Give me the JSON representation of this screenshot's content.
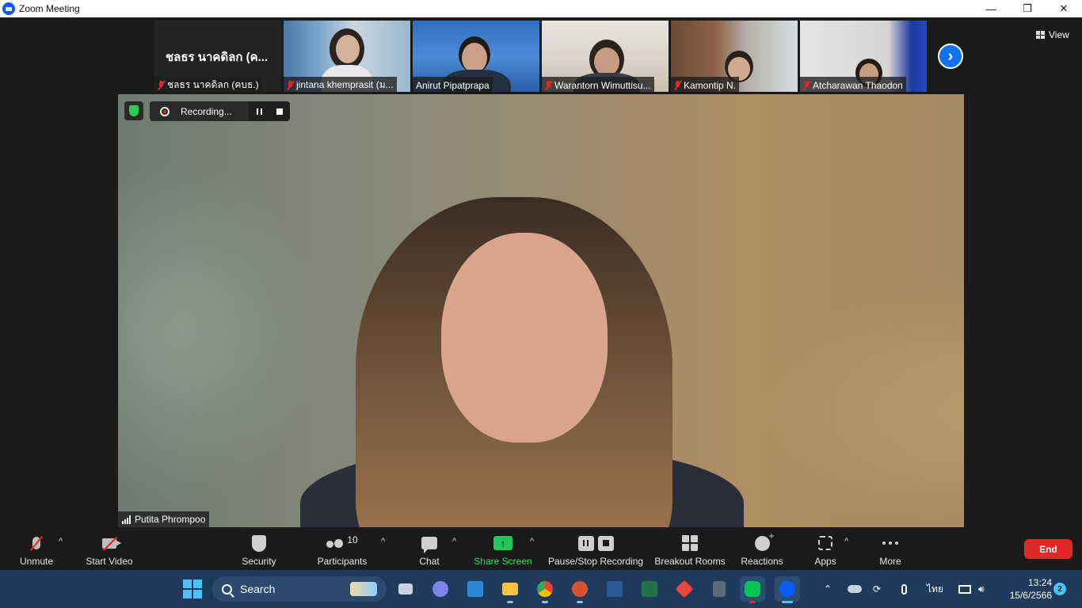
{
  "window": {
    "title": "Zoom Meeting",
    "buttons": {
      "minimize": "—",
      "restore": "❐",
      "close": "✕"
    }
  },
  "gallery": {
    "namecard": {
      "big_name": "ชลธร นาคดิลก (ค...",
      "label": "ชลธร นาคดิลก (คบธ.)"
    },
    "participants": [
      {
        "name": "jintana khemprasit (ม...",
        "muted": true
      },
      {
        "name": "Anirut Pipatprapa",
        "muted": false
      },
      {
        "name": "Warantorn Wimuttisu...",
        "muted": true
      },
      {
        "name": "Kamontip N.",
        "muted": true
      },
      {
        "name": "Atcharawan Thaodon",
        "muted": true
      }
    ],
    "next_icon": "chevron-right-icon",
    "view_label": "View"
  },
  "main_video": {
    "speaker_name": "Putita Phrompoo",
    "recording_label": "Recording..."
  },
  "toolbar": {
    "unmute": "Unmute",
    "start_video": "Start Video",
    "security": "Security",
    "participants": "Participants",
    "participants_count": "10",
    "chat": "Chat",
    "share_screen": "Share Screen",
    "pause_stop_recording": "Pause/Stop Recording",
    "breakout_rooms": "Breakout Rooms",
    "reactions": "Reactions",
    "apps": "Apps",
    "more": "More",
    "end": "End"
  },
  "taskbar": {
    "search_label": "Search",
    "language": "ไทย",
    "time": "13:24",
    "date": "15/6/2566",
    "notification_count": "2"
  },
  "colors": {
    "accent_blue": "#0e72ed",
    "end_red": "#e02828",
    "share_green": "#22c55e",
    "taskbar_bg": "#1f3a5c"
  }
}
